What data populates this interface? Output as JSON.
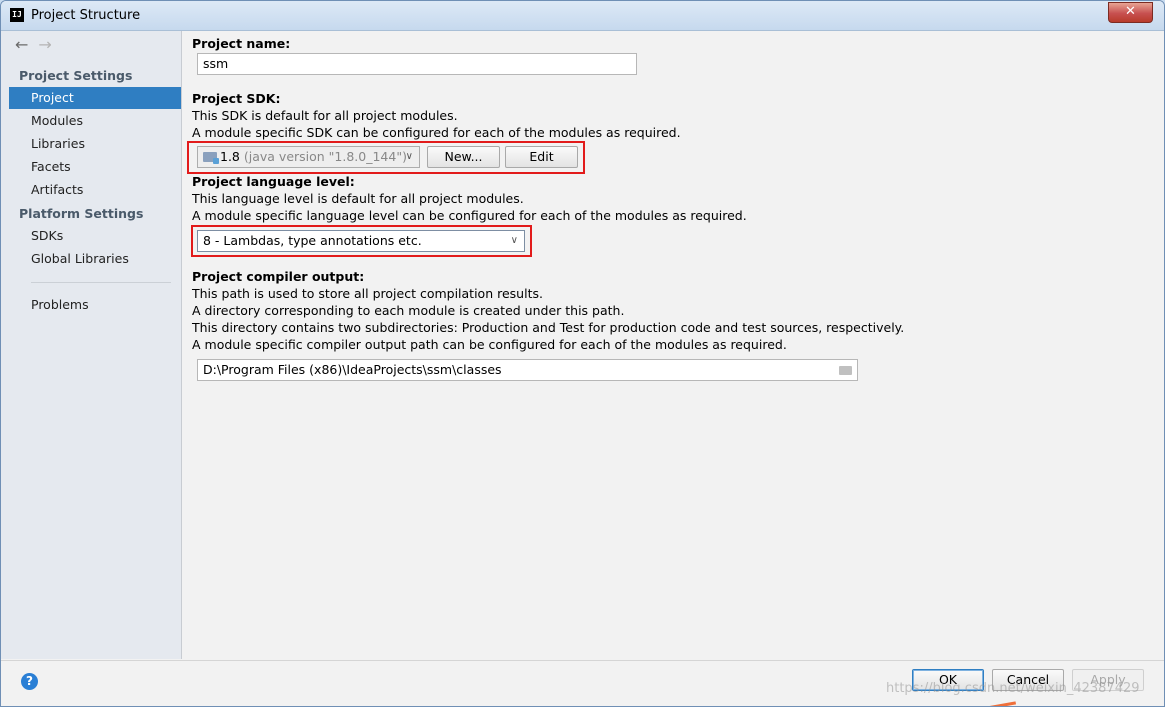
{
  "window": {
    "title": "Project Structure",
    "app_icon_text": "IJ",
    "close_glyph": "✕"
  },
  "sidebar": {
    "back_arrow": "←",
    "forward_arrow": "→",
    "project_settings_header": "Project Settings",
    "project_items": [
      {
        "label": "Project",
        "selected": true
      },
      {
        "label": "Modules"
      },
      {
        "label": "Libraries"
      },
      {
        "label": "Facets"
      },
      {
        "label": "Artifacts"
      }
    ],
    "platform_settings_header": "Platform Settings",
    "platform_items": [
      {
        "label": "SDKs"
      },
      {
        "label": "Global Libraries"
      }
    ],
    "problems_label": "Problems"
  },
  "main": {
    "project_name": {
      "label": "Project name:",
      "value": "ssm"
    },
    "project_sdk": {
      "label": "Project SDK:",
      "line1": "This SDK is default for all project modules.",
      "line2": "A module specific SDK can be configured for each of the modules as required.",
      "selected_version": "1.8",
      "selected_detail": "(java version \"1.8.0_144\")",
      "new_button": "New...",
      "edit_button": "Edit"
    },
    "language_level": {
      "label": "Project language level:",
      "line1": "This language level is default for all project modules.",
      "line2": "A module specific language level can be configured for each of the modules as required.",
      "selected": "8 - Lambdas, type annotations etc."
    },
    "compiler_output": {
      "label": "Project compiler output:",
      "line1": "This path is used to store all project compilation results.",
      "line2": "A directory corresponding to each module is created under this path.",
      "line3": "This directory contains two subdirectories: Production and Test for production code and test sources, respectively.",
      "line4": "A module specific compiler output path can be configured for each of the modules as required.",
      "path": "D:\\Program Files (x86)\\IdeaProjects\\ssm\\classes"
    }
  },
  "footer": {
    "help_glyph": "?",
    "ok_button": "OK",
    "cancel_button": "Cancel",
    "apply_button": "Apply",
    "watermark": "https://blog.csdn.net/weixin_42387429"
  },
  "colors": {
    "selection": "#2f7ec2",
    "highlight_box": "#e21b1b"
  }
}
